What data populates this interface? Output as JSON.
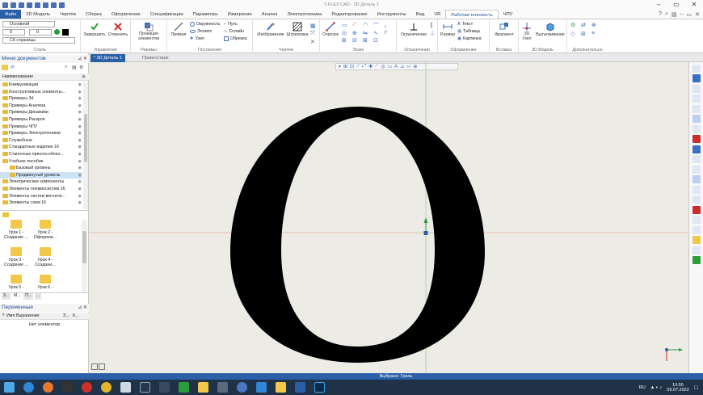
{
  "window": {
    "title": "T-FLEX CAD - 3D Деталь 1",
    "controls": [
      "–",
      "▭",
      "✕"
    ]
  },
  "menu": {
    "tabs": [
      "Файл",
      "3D Модель",
      "Чертёж",
      "Сборка",
      "Оформление",
      "Спецификации",
      "Параметры",
      "Измерение",
      "Анализ",
      "Электротехника",
      "Редактирование",
      "Инструменты",
      "Вид",
      "VR",
      "Рабочая плоскость",
      "ЧПУ"
    ],
    "active_tab": "Рабочая плоскость"
  },
  "ribbon": {
    "style": {
      "layer_value": "Основной",
      "num1": "0",
      "num2": "0",
      "cs_value": "СК страницы",
      "label": "Стиль"
    },
    "control": {
      "finish": "Завершить",
      "cancel": "Отменить",
      "label": "Управление"
    },
    "modes": {
      "projection": "Проекция элементов",
      "label": "Режимы"
    },
    "construction": {
      "line": "Прямая",
      "circle": "Окружность",
      "ellipse": "Эллипс",
      "node": "Узел",
      "path": "Путь",
      "spline": "Сплайн",
      "clip": "Обрезка",
      "label": "Построения"
    },
    "drawings": {
      "image": "Изображение",
      "hatch": "Штриховка",
      "label": "Чертеж"
    },
    "sketch": {
      "segment": "Отрезок",
      "label": "Эскиз"
    },
    "constraints": {
      "constraint": "Ограничение",
      "label": "Ограничения"
    },
    "annotation": {
      "size": "Размер",
      "text": "Текст",
      "table": "Таблица",
      "picture": "Картинка",
      "label": "Оформление"
    },
    "insert": {
      "fragment": "Фрагмент",
      "label": "Вставка"
    },
    "model3d": {
      "node3d": "3D Узел",
      "extrude": "Выталкивание",
      "label": "3D Модель"
    },
    "extra": {
      "label": "Дополнительно"
    }
  },
  "doc_menu": {
    "title": "Меню документов",
    "column": "Наименование",
    "items": [
      {
        "label": "Коммуникации",
        "selected": false
      },
      {
        "label": "Конструктивные элементы...",
        "selected": false
      },
      {
        "label": "Примеры 3d",
        "selected": false
      },
      {
        "label": "Примеры Анализа",
        "selected": false
      },
      {
        "label": "Примеры Динамики",
        "selected": false
      },
      {
        "label": "Примеры Раскроя",
        "selected": false
      },
      {
        "label": "Примеры ЧПУ",
        "selected": false
      },
      {
        "label": "Примеры Электротехники",
        "selected": false
      },
      {
        "label": "Служебные",
        "selected": false
      },
      {
        "label": "Стандартные изделия 16",
        "selected": false
      },
      {
        "label": "Станочные приспособлен...",
        "selected": false
      },
      {
        "label": "Учебное пособие",
        "selected": false
      },
      {
        "label": "Базовый уровень",
        "selected": false
      },
      {
        "label": "Продвинутый уровень",
        "selected": true
      },
      {
        "label": "Электрические компоненты",
        "selected": false
      },
      {
        "label": "Элементы пневмосистем 16",
        "selected": false
      },
      {
        "label": "Элементы систем вентиля...",
        "selected": false
      },
      {
        "label": "Элементы схем 16",
        "selected": false
      }
    ],
    "tiles": [
      {
        "label": "Урок 1 - Создание ..."
      },
      {
        "label": "Урок 2 - Оформле..."
      },
      {
        "label": "Урок 3 - Создание ..."
      },
      {
        "label": "Урок 4 - Создани..."
      },
      {
        "label": "Урок 5 -"
      },
      {
        "label": "Урок 6 -"
      }
    ],
    "bottom_tabs": [
      "3...",
      "М...",
      "П...",
      "..."
    ]
  },
  "variables": {
    "title": "Переменные",
    "col_q": "?",
    "col_name": "Имя",
    "col_expr": "Выражение",
    "col_3": "З...",
    "col_k": "К...",
    "empty": "Нет элементов"
  },
  "doc_tabs": [
    {
      "label": "* 3D Деталь 1",
      "active": true
    },
    {
      "label": "Приветствие",
      "active": false
    }
  ],
  "status": {
    "text": "Выбрано: Грань"
  },
  "taskbar": {
    "lang": "RU",
    "time": "10:55",
    "date": "09.07.2022"
  },
  "colors": {
    "accent": "#2b5fa8",
    "viewport": "#ecebe5",
    "shape": "#000000"
  }
}
